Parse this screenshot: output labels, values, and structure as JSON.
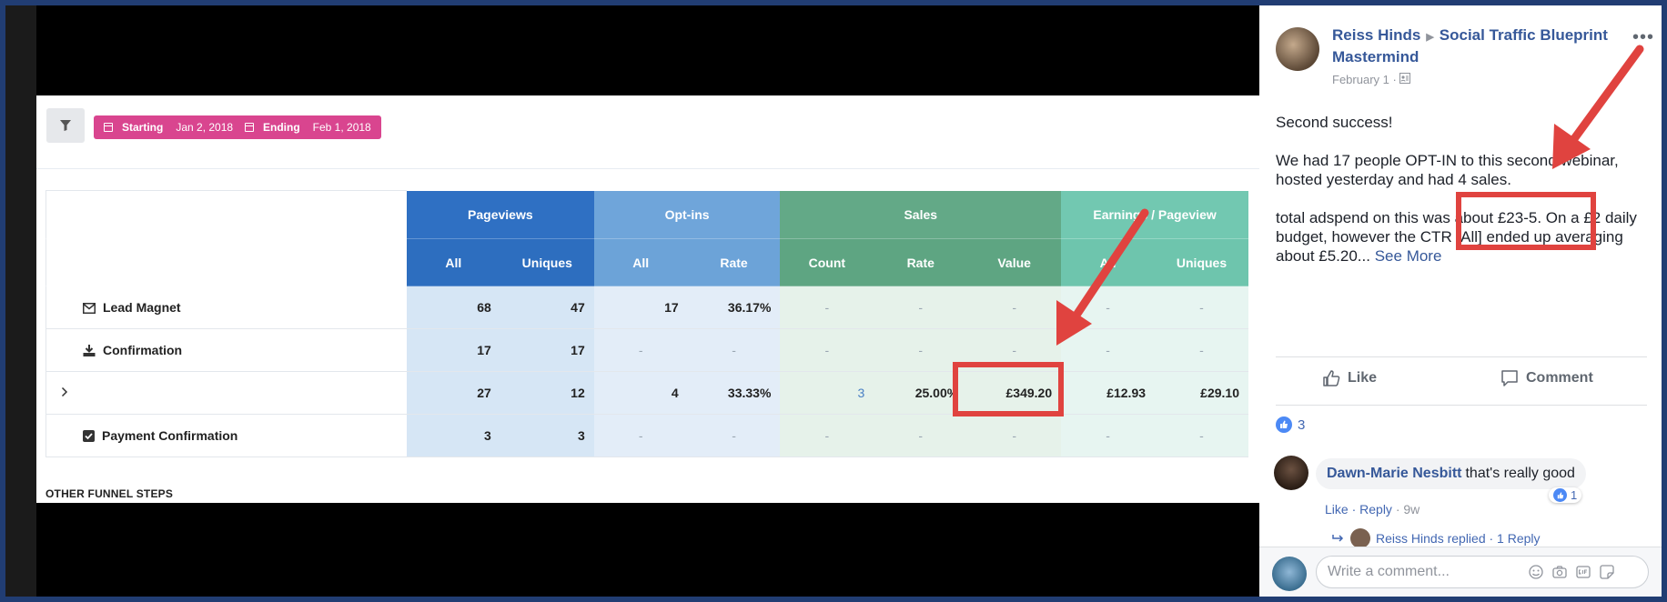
{
  "dashboard": {
    "starting_label": "Starting",
    "starting_date": "Jan 2, 2018",
    "ending_label": "Ending",
    "ending_date": "Feb 1, 2018",
    "groups": [
      "Pageviews",
      "Opt-ins",
      "Sales",
      "Earnings / Pageview"
    ],
    "columns": [
      "All",
      "Uniques",
      "All",
      "Rate",
      "Count",
      "Rate",
      "Value",
      "All",
      "Uniques"
    ],
    "rows": [
      {
        "name": "Lead Magnet",
        "icon": "envelope-icon",
        "cells": [
          "68",
          "47",
          "17",
          "36.17%",
          "-",
          "-",
          "-",
          "-",
          "-"
        ]
      },
      {
        "name": "Confirmation",
        "icon": "download-icon",
        "cells": [
          "17",
          "17",
          "-",
          "-",
          "-",
          "-",
          "-",
          "-",
          "-"
        ]
      },
      {
        "name": "",
        "icon": "chevron-right-icon",
        "cells": [
          "27",
          "12",
          "4",
          "33.33%",
          "3",
          "25.00%",
          "£349.20",
          "£12.93",
          "£29.10"
        ]
      },
      {
        "name": "Payment Confirmation",
        "icon": "checkbox-icon",
        "cells": [
          "3",
          "3",
          "-",
          "-",
          "-",
          "-",
          "-",
          "-",
          "-"
        ]
      }
    ],
    "other_steps": "OTHER FUNNEL STEPS"
  },
  "post": {
    "author": "Reiss Hinds",
    "group": "Social Traffic Blueprint Mastermind",
    "date": "February 1 ·",
    "body": [
      "Second success!",
      "We had 17 people OPT-IN to this second webinar, hosted yesterday and had 4 sales.",
      "total adspend on this was about £23-5. On a £2 daily budget, however the CTR [All] ended up averaging about £5.20..."
    ],
    "see_more": "See More",
    "like_label": "Like",
    "comment_label": "Comment",
    "like_count": "3",
    "comment": {
      "author": "Dawn-Marie Nesbitt",
      "text": "that's really good",
      "reaction_count": "1",
      "like": "Like",
      "reply": "Reply",
      "age": "9w"
    },
    "replies_text": "Reiss Hinds replied · 1 Reply",
    "composer_placeholder": "Write a comment..."
  },
  "colors": {
    "pageviews": "#2f70c3",
    "optins": "#6fa5da",
    "sales": "#63a987",
    "earnings": "#72c8b1",
    "date_chip": "#d9458f",
    "annotation_red": "#e0433f",
    "fb_link": "#365899"
  }
}
